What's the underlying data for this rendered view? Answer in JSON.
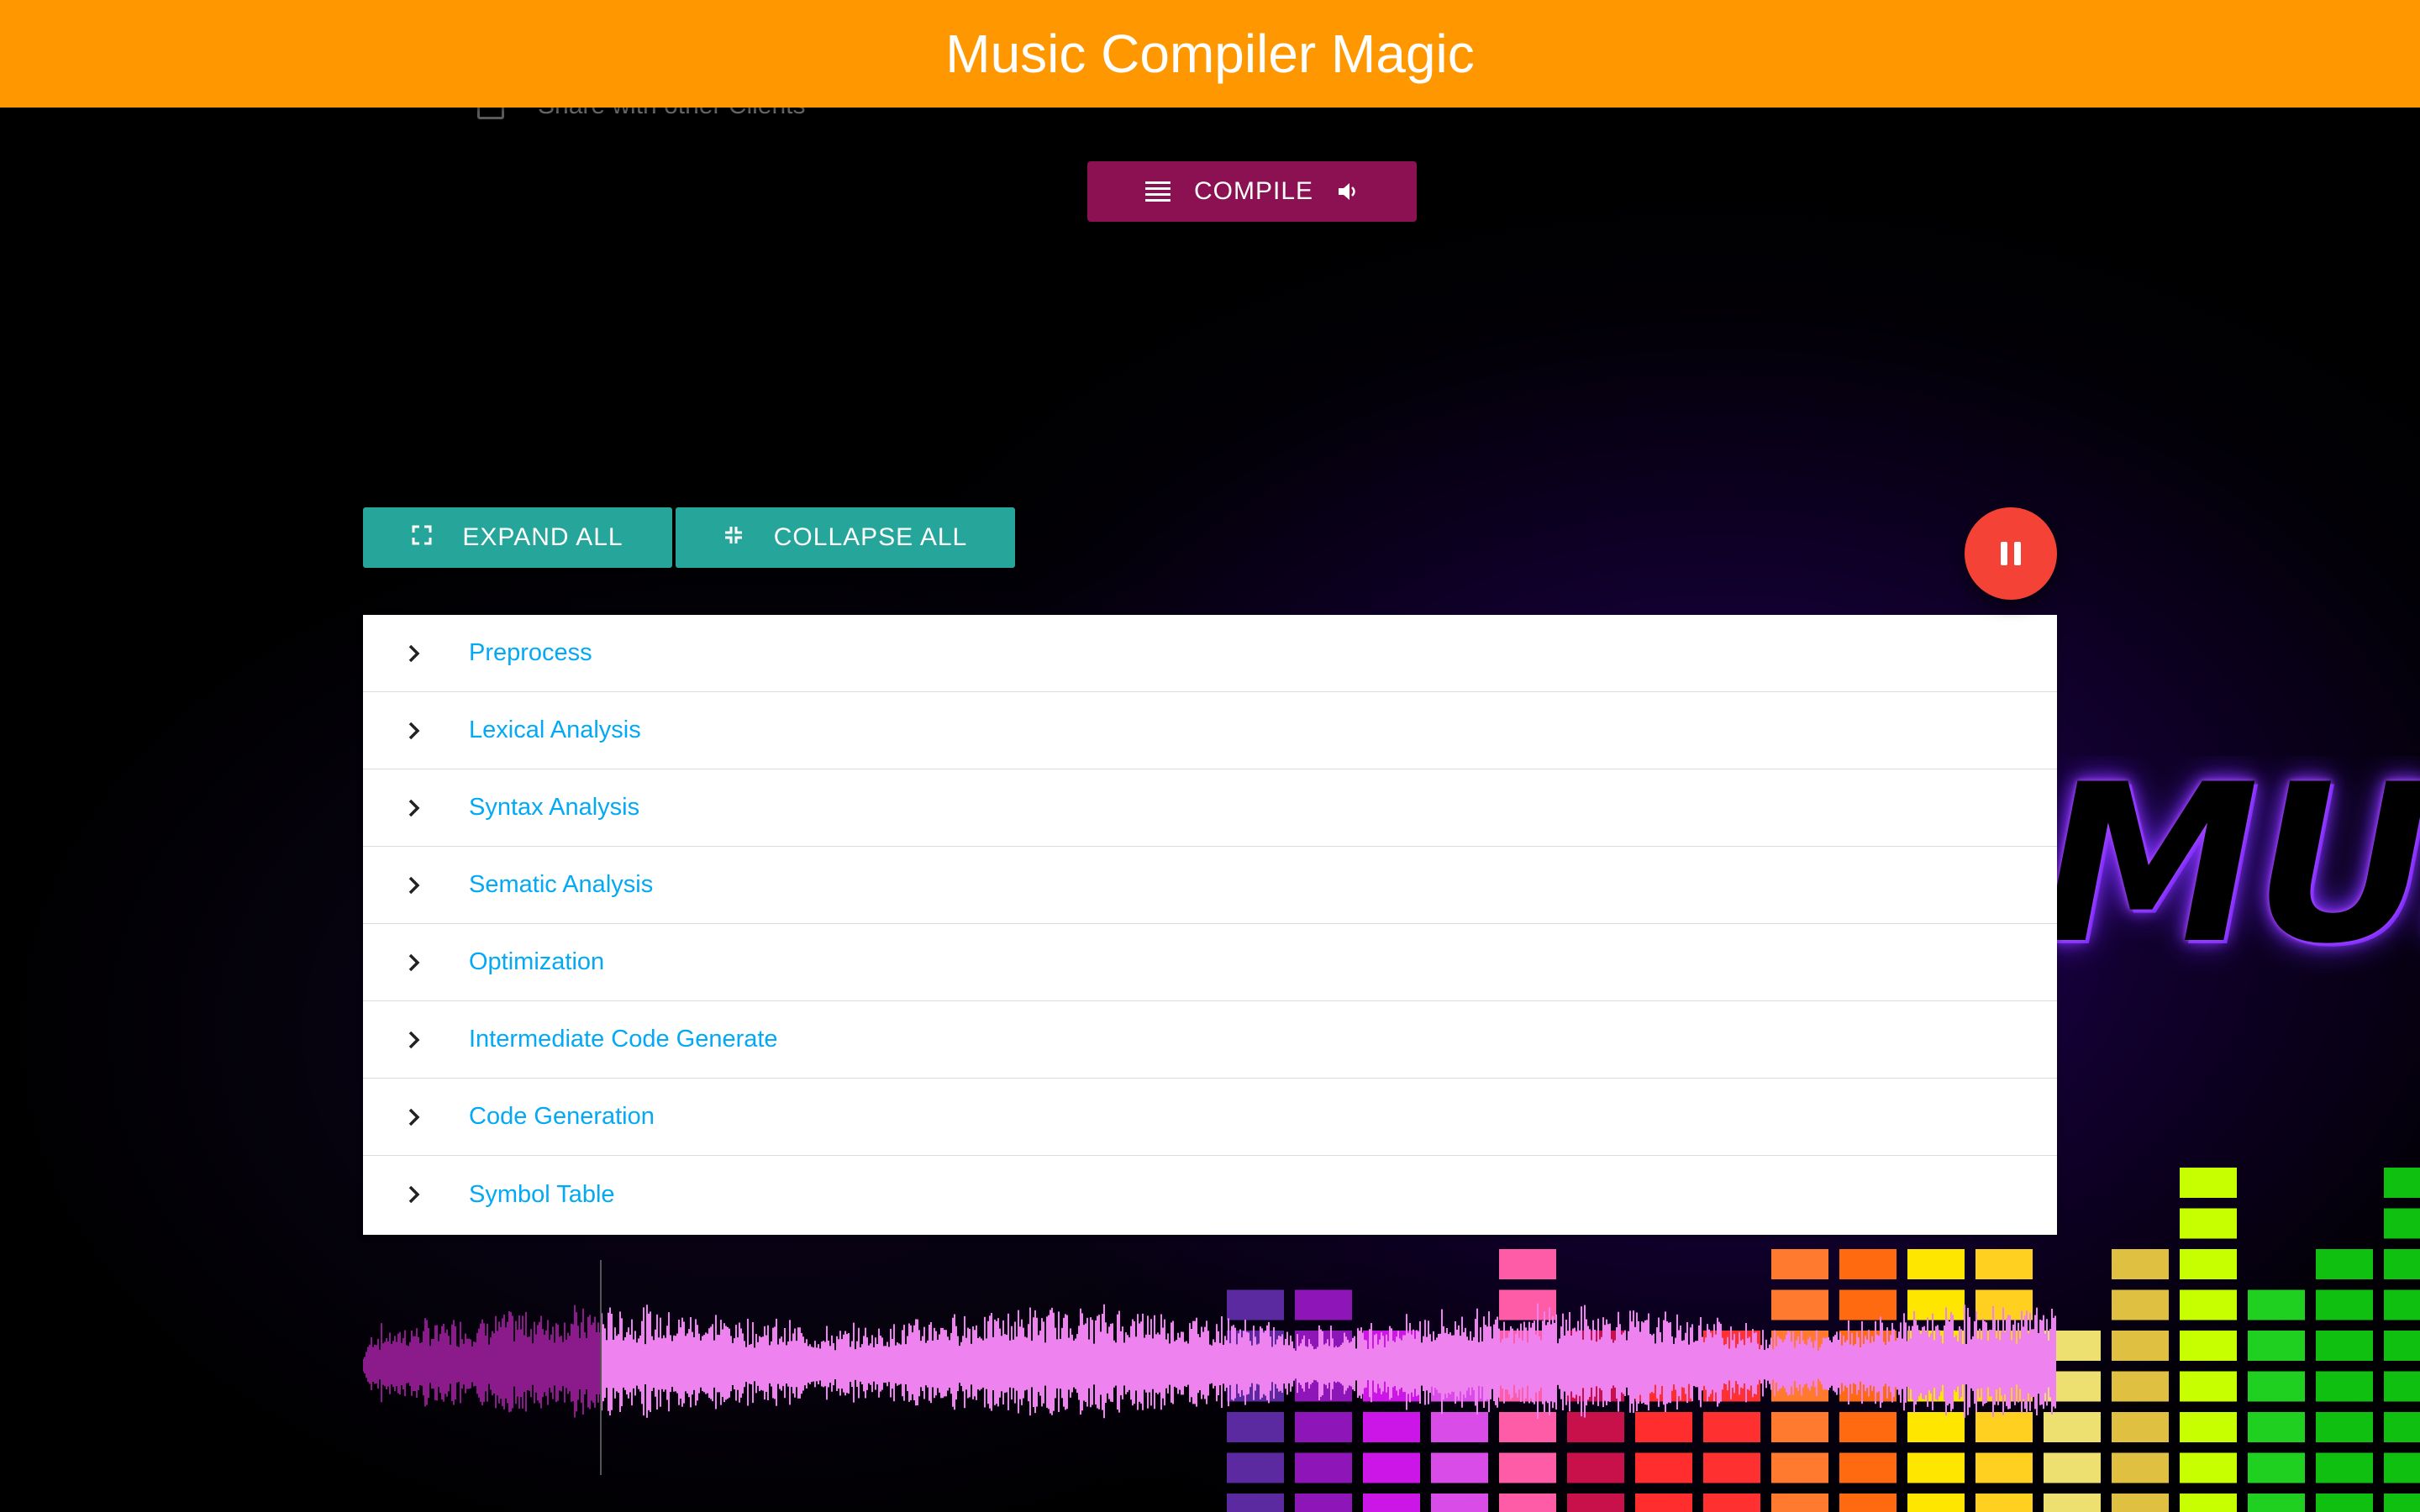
{
  "header": {
    "title": "Music Compiler Magic"
  },
  "share": {
    "label": "Share with other Clients",
    "checked": false
  },
  "compile": {
    "label": "COMPILE"
  },
  "actions": {
    "expand_label": "EXPAND ALL",
    "collapse_label": "COLLAPSE ALL"
  },
  "player": {
    "state": "playing",
    "progress": 0.14
  },
  "panel": {
    "items": [
      {
        "label": "Preprocess"
      },
      {
        "label": "Lexical Analysis"
      },
      {
        "label": "Syntax Analysis"
      },
      {
        "label": "Sematic Analysis"
      },
      {
        "label": "Optimization"
      },
      {
        "label": "Intermediate Code Generate"
      },
      {
        "label": "Code Generation"
      },
      {
        "label": "Symbol Table"
      }
    ]
  },
  "background": {
    "word": "MUS"
  },
  "colors": {
    "header": "#ff9800",
    "compile": "#8b1153",
    "action": "#26a69a",
    "fab": "#f44336",
    "link": "#03a9f4",
    "wave_played": "#8b1a8b",
    "wave_unplayed": "#ee82ee"
  },
  "icons": {
    "compile_left": "list-icon",
    "compile_right": "volume-icon",
    "expand": "fullscreen-icon",
    "collapse": "fullscreen-exit-icon",
    "fab": "pause-icon",
    "item": "chevron-right-icon"
  }
}
